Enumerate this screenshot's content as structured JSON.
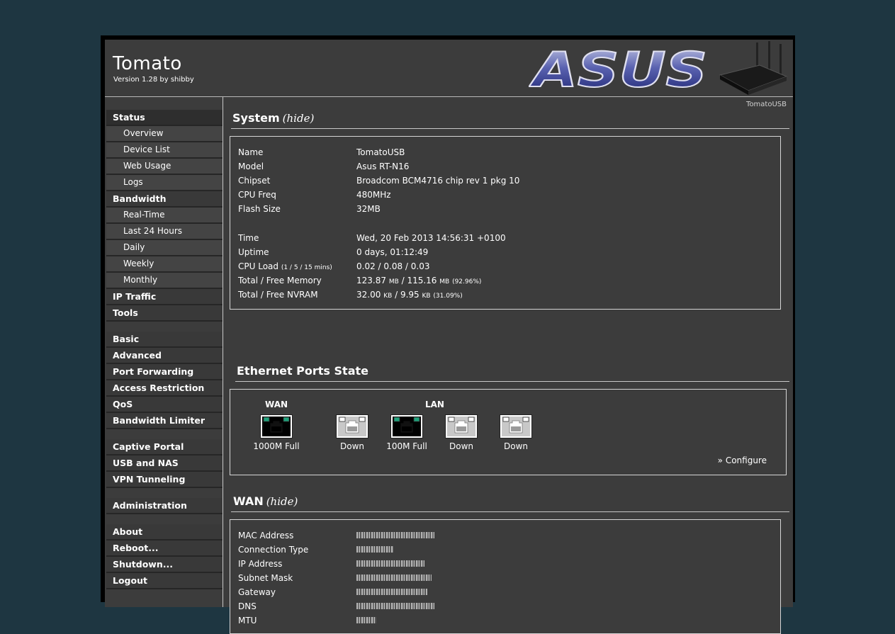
{
  "header": {
    "title": "Tomato",
    "version": "Version 1.28 by shibby",
    "logo_text": "ASUS"
  },
  "sidebar": {
    "groups": [
      [
        {
          "label": "Status",
          "level": "top",
          "active": true
        },
        {
          "label": "Overview",
          "level": "sub"
        },
        {
          "label": "Device List",
          "level": "sub"
        },
        {
          "label": "Web Usage",
          "level": "sub"
        },
        {
          "label": "Logs",
          "level": "sub"
        },
        {
          "label": "Bandwidth",
          "level": "top"
        },
        {
          "label": "Real-Time",
          "level": "sub"
        },
        {
          "label": "Last 24 Hours",
          "level": "sub"
        },
        {
          "label": "Daily",
          "level": "sub"
        },
        {
          "label": "Weekly",
          "level": "sub"
        },
        {
          "label": "Monthly",
          "level": "sub"
        },
        {
          "label": "IP Traffic",
          "level": "top"
        },
        {
          "label": "Tools",
          "level": "top"
        }
      ],
      [
        {
          "label": "Basic",
          "level": "top"
        },
        {
          "label": "Advanced",
          "level": "top"
        },
        {
          "label": "Port Forwarding",
          "level": "top"
        },
        {
          "label": "Access Restriction",
          "level": "top"
        },
        {
          "label": "QoS",
          "level": "top"
        },
        {
          "label": "Bandwidth Limiter",
          "level": "top"
        }
      ],
      [
        {
          "label": "Captive Portal",
          "level": "top"
        },
        {
          "label": "USB and NAS",
          "level": "top"
        },
        {
          "label": "VPN Tunneling",
          "level": "top"
        }
      ],
      [
        {
          "label": "Administration",
          "level": "top"
        }
      ],
      [
        {
          "label": "About",
          "level": "top"
        },
        {
          "label": "Reboot...",
          "level": "top"
        },
        {
          "label": "Shutdown...",
          "level": "top"
        },
        {
          "label": "Logout",
          "level": "top"
        }
      ]
    ]
  },
  "router_name": "TomatoUSB",
  "system": {
    "title": "System",
    "hide": "(hide)",
    "name_label": "Name",
    "name": "TomatoUSB",
    "model_label": "Model",
    "model": "Asus RT-N16",
    "chipset_label": "Chipset",
    "chipset": "Broadcom BCM4716 chip rev 1 pkg 10",
    "cpufreq_label": "CPU Freq",
    "cpufreq": "480MHz",
    "flash_label": "Flash Size",
    "flash": "32MB",
    "time_label": "Time",
    "time": "Wed, 20 Feb 2013 14:56:31 +0100",
    "uptime_label": "Uptime",
    "uptime": "0 days, 01:12:49",
    "cpuload_label": "CPU Load",
    "cpuload_sub": "(1 / 5 / 15 mins)",
    "cpuload": "0.02 / 0.08 / 0.03",
    "memory_label": "Total / Free Memory",
    "mem_total": "123.87",
    "mem_free": "115.16",
    "mem_unit": "MB",
    "mem_pct": "(92.96%)",
    "nvram_label": "Total / Free NVRAM",
    "nvram_total": "32.00",
    "nvram_free": "9.95",
    "nvram_unit": "KB",
    "nvram_pct": "(31.09%)"
  },
  "ethernet": {
    "title": "Ethernet Ports State",
    "wan_label": "WAN",
    "lan_label": "LAN",
    "ports": [
      {
        "status": "1000M Full",
        "up": true
      },
      {
        "status": "Down",
        "up": false
      },
      {
        "status": "100M Full",
        "up": true
      },
      {
        "status": "Down",
        "up": false
      },
      {
        "status": "Down",
        "up": false
      }
    ],
    "configure": "» Configure"
  },
  "wan": {
    "title": "WAN",
    "hide": "(hide)",
    "mac_label": "MAC Address",
    "conn_label": "Connection Type",
    "ip_label": "IP Address",
    "mask_label": "Subnet Mask",
    "gw_label": "Gateway",
    "dns_label": "DNS",
    "mtu_label": "MTU"
  }
}
